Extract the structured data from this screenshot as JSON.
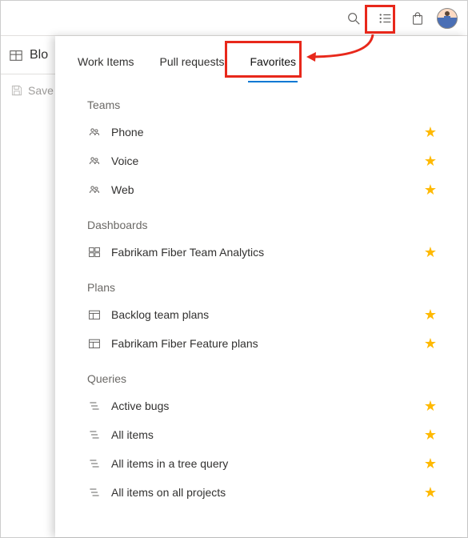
{
  "topbar": {
    "search_label": "Search",
    "list_label": "Favorites list",
    "marketplace_label": "Marketplace",
    "avatar_label": "User account"
  },
  "page": {
    "title_truncated": "Blo",
    "save_label": "Save"
  },
  "panel": {
    "tabs": [
      {
        "label": "Work Items",
        "active": false
      },
      {
        "label": "Pull requests",
        "active": false
      },
      {
        "label": "Favorites",
        "active": true
      }
    ],
    "sections": [
      {
        "title": "Teams",
        "icon": "team",
        "items": [
          {
            "label": "Phone"
          },
          {
            "label": "Voice"
          },
          {
            "label": "Web"
          }
        ]
      },
      {
        "title": "Dashboards",
        "icon": "dashboard",
        "items": [
          {
            "label": "Fabrikam Fiber Team Analytics"
          }
        ]
      },
      {
        "title": "Plans",
        "icon": "plan",
        "items": [
          {
            "label": "Backlog team plans"
          },
          {
            "label": "Fabrikam Fiber Feature plans"
          }
        ]
      },
      {
        "title": "Queries",
        "icon": "query",
        "items": [
          {
            "label": "Active bugs"
          },
          {
            "label": "All items"
          },
          {
            "label": "All items in a tree query"
          },
          {
            "label": "All items on all projects"
          }
        ]
      }
    ]
  }
}
